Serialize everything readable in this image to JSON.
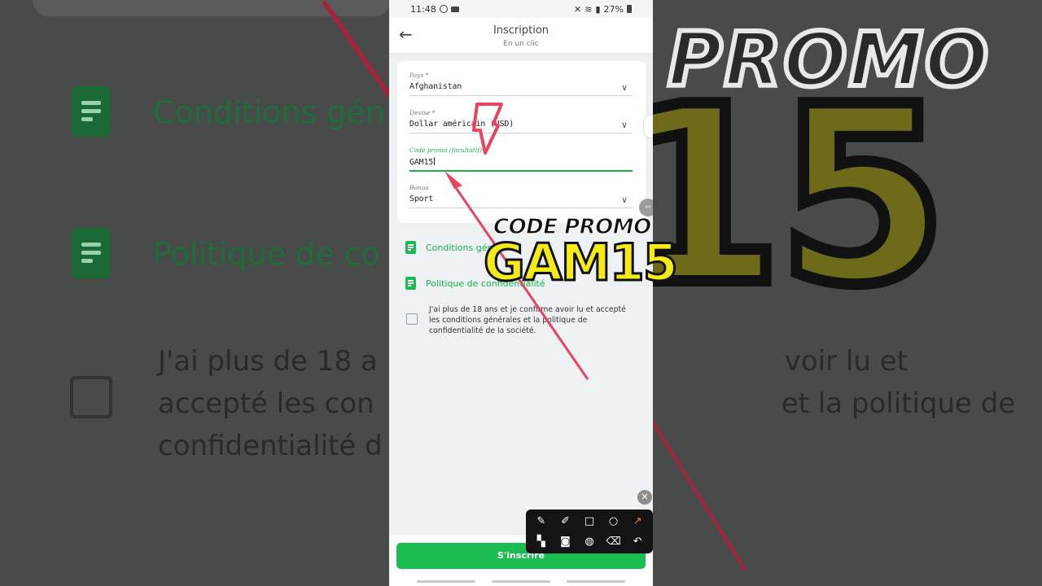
{
  "status": {
    "time": "11:48",
    "battery": "27%"
  },
  "header": {
    "title": "Inscription",
    "subtitle": "En un clic"
  },
  "form": {
    "country": {
      "label": "Pays *",
      "value": "Afghanistan"
    },
    "currency": {
      "label": "Devise *",
      "value": "Dollar américain (USD)"
    },
    "promo": {
      "label": "Code promo (facultatif)",
      "value": "GAM15"
    },
    "bonus": {
      "label": "Bonus",
      "value": "Sport"
    }
  },
  "links": {
    "terms": "Conditions générales",
    "privacy": "Politique de confidentialité"
  },
  "consent": "J'ai plus de 18 ans et je confirme avoir lu et accepté les conditions générales et la politique de confidentialité de la société.",
  "background": {
    "terms_short": "Conditions gén",
    "privacy_short": "Politique de co",
    "consent_line1a": "J'ai plus de 18 a",
    "consent_line1b": "voir lu et",
    "consent_line2a": "accepté les con",
    "consent_line2b": "et la politique de",
    "consent_line3": "confidentialité d"
  },
  "signup_label": "S'inscrire",
  "overlay": {
    "promo_label": "CODE PROMO",
    "promo_code": "GAM15"
  },
  "icons": {
    "back": "arrow-left-icon",
    "chevron": "chevron-down-icon",
    "doc": "document-icon"
  },
  "colors": {
    "accent": "#1bbd52",
    "promo_yellow": "#f3ea16",
    "arrow_red": "#e8435f"
  }
}
